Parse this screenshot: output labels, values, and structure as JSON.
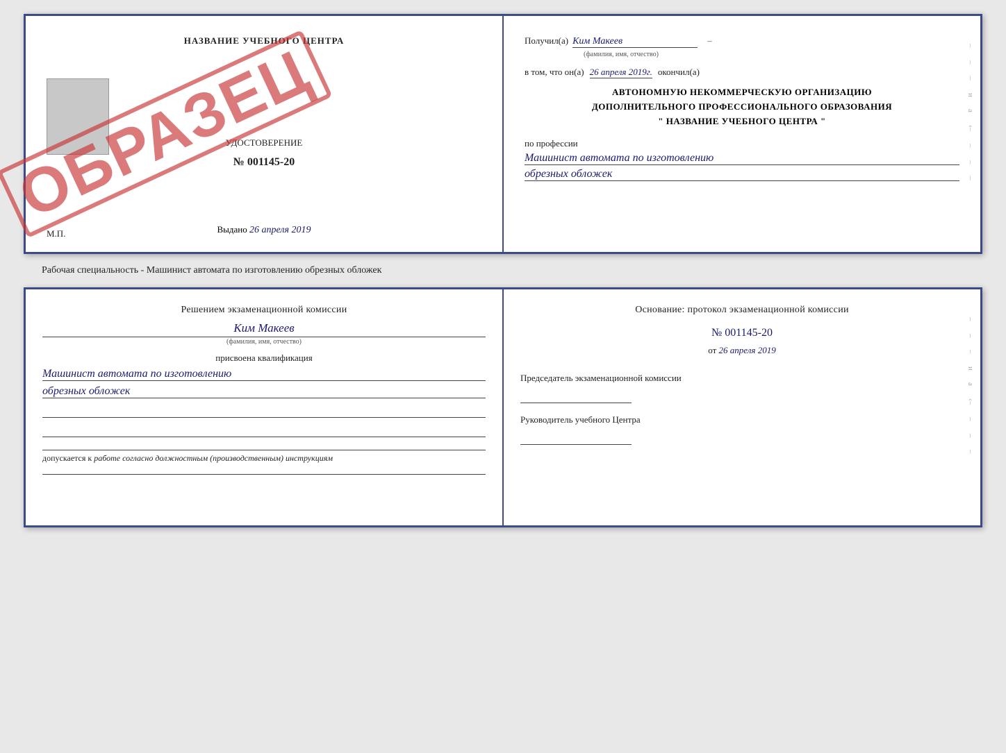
{
  "top_document": {
    "left": {
      "title": "НАЗВАНИЕ УЧЕБНОГО ЦЕНТРА",
      "cert_label": "УДОСТОВЕРЕНИЕ",
      "cert_number": "№ 001145-20",
      "issued_prefix": "Выдано",
      "issued_date": "26 апреля 2019",
      "mp_label": "М.П.",
      "obrazec": "ОБРАЗЕЦ"
    },
    "right": {
      "received_label": "Получил(а)",
      "received_name": "Ким Макеев",
      "fio_sub": "(фамилия, имя, отчество)",
      "vtom_label": "в том, что он(а)",
      "vtom_date": "26 апреля 2019г.",
      "okончил_label": "окончил(а)",
      "org_line1": "АВТОНОМНУЮ НЕКОММЕРЧЕСКУЮ ОРГАНИЗАЦИЮ",
      "org_line2": "ДОПОЛНИТЕЛЬНОГО ПРОФЕССИОНАЛЬНОГО ОБРАЗОВАНИЯ",
      "org_line3": "\"  НАЗВАНИЕ УЧЕБНОГО ЦЕНТРА  \"",
      "profession_label": "по профессии",
      "profession_value1": "Машинист автомата по изготовлению",
      "profession_value2": "обрезных обложек"
    }
  },
  "caption": "Рабочая специальность - Машинист автомата по изготовлению обрезных обложек",
  "bottom_document": {
    "left": {
      "decision_heading": "Решением экзаменационной комиссии",
      "person_name": "Ким Макеев",
      "fio_sub": "(фамилия, имя, отчество)",
      "assigned_label": "присвоена квалификация",
      "qualification_value1": "Машинист автомата по изготовлению",
      "qualification_value2": "обрезных обложек",
      "allowed_prefix": "допускается к",
      "allowed_italic": "работе согласно должностным (производственным) инструкциям"
    },
    "right": {
      "basis_heading": "Основание: протокол экзаменационной комиссии",
      "protocol_number": "№  001145-20",
      "date_prefix": "от",
      "protocol_date": "26 апреля 2019",
      "chairman_label": "Председатель экзаменационной комиссии",
      "director_label": "Руководитель учебного Центра"
    }
  },
  "side_decorations": {
    "items": [
      "–",
      "–",
      "–",
      "и",
      "а",
      "‹–",
      "–",
      "–",
      "–"
    ]
  }
}
